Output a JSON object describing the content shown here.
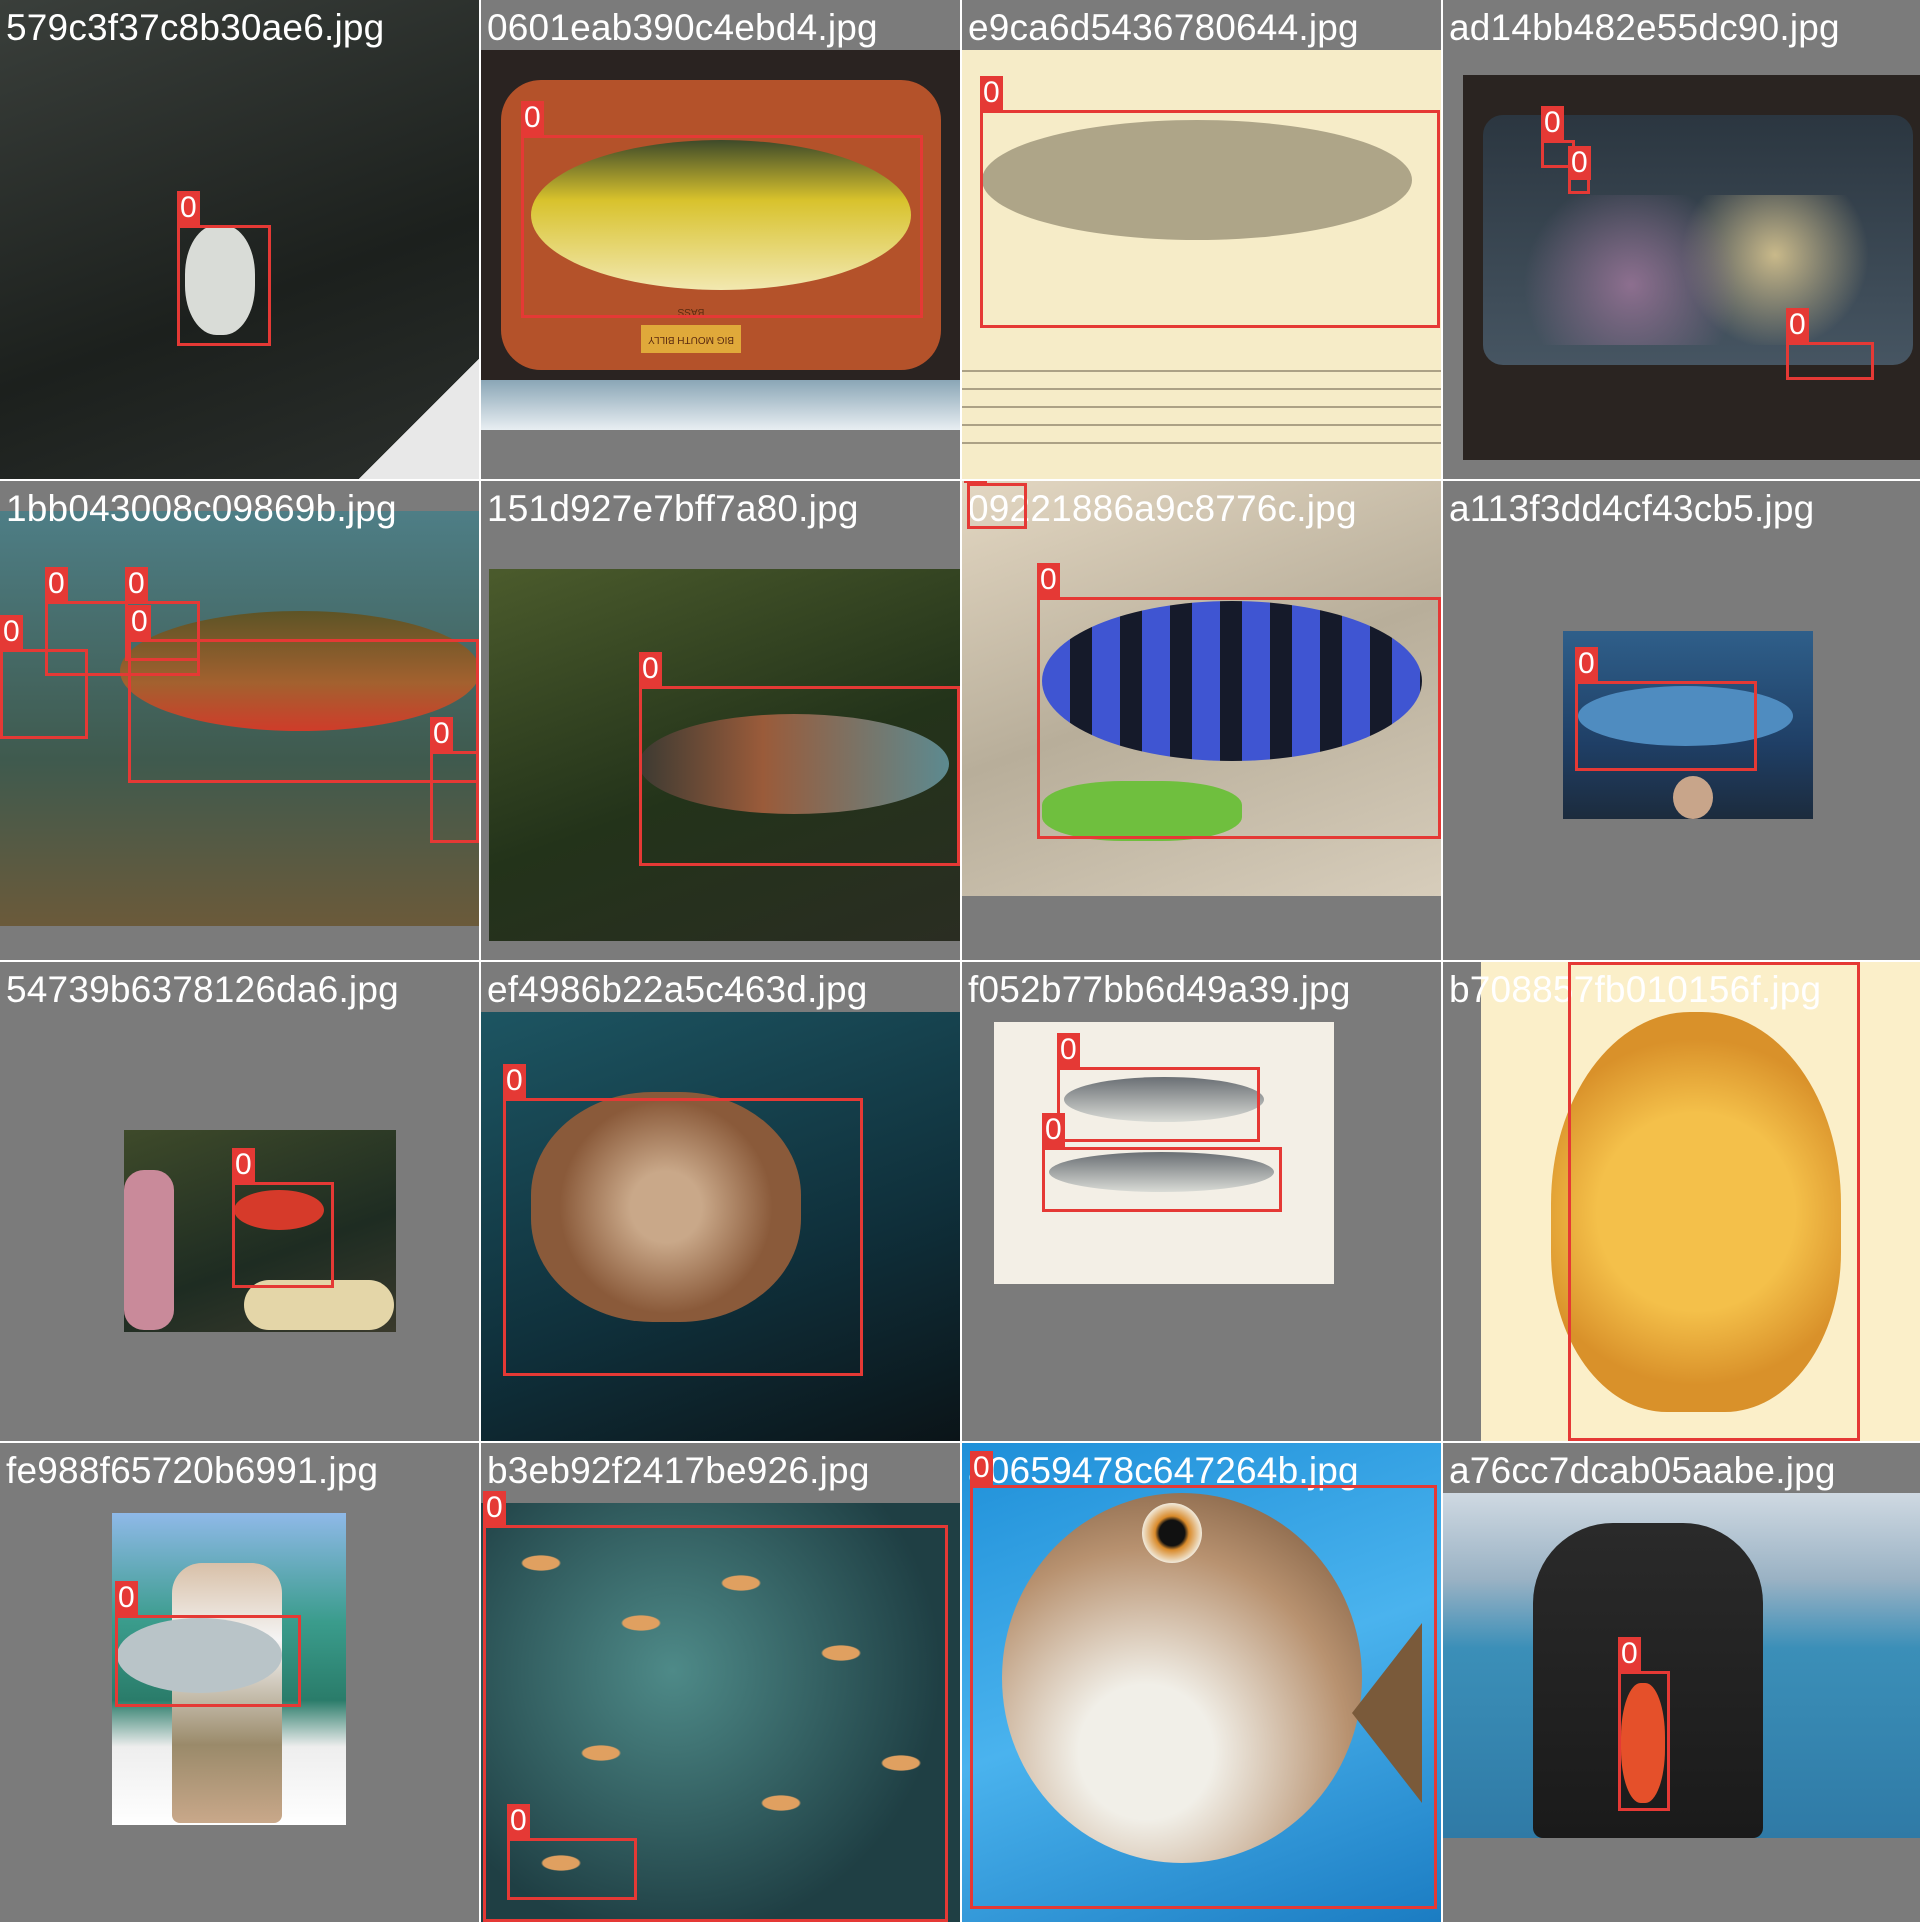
{
  "tiles": [
    {
      "file": "579c3f37c8b30ae6.jpg",
      "boxes": [
        {
          "label": "0"
        }
      ]
    },
    {
      "file": "0601eab390c4ebd4.jpg",
      "boxes": [
        {
          "label": "0"
        }
      ],
      "plaque_text": "BIG MOUTH BILLY BASS"
    },
    {
      "file": "e9ca6d5436780644.jpg",
      "boxes": [
        {
          "label": "0"
        }
      ]
    },
    {
      "file": "ad14bb482e55dc90.jpg",
      "boxes": [
        {
          "label": "0"
        },
        {
          "label": "0"
        },
        {
          "label": "0"
        }
      ]
    },
    {
      "file": "1bb043008c09869b.jpg",
      "boxes": [
        {
          "label": "0"
        },
        {
          "label": "0"
        },
        {
          "label": "0"
        },
        {
          "label": "0"
        },
        {
          "label": "0"
        }
      ]
    },
    {
      "file": "151d927e7bff7a80.jpg",
      "boxes": [
        {
          "label": "0"
        }
      ]
    },
    {
      "file": "09221886a9c8776c.jpg",
      "boxes": [
        {
          "label": "0"
        },
        {
          "label": "0"
        }
      ]
    },
    {
      "file": "a113f3dd4cf43cb5.jpg",
      "boxes": [
        {
          "label": "0"
        }
      ]
    },
    {
      "file": "54739b6378126da6.jpg",
      "boxes": [
        {
          "label": "0"
        }
      ]
    },
    {
      "file": "ef4986b22a5c463d.jpg",
      "boxes": [
        {
          "label": "0"
        }
      ]
    },
    {
      "file": "f052b77bb6d49a39.jpg",
      "boxes": [
        {
          "label": "0"
        },
        {
          "label": "0"
        }
      ]
    },
    {
      "file": "b708857fb010156f.jpg",
      "boxes": [
        {
          "label": "0"
        }
      ]
    },
    {
      "file": "fe988f65720b6991.jpg",
      "boxes": [
        {
          "label": "0"
        }
      ]
    },
    {
      "file": "b3eb92f2417be926.jpg",
      "boxes": [
        {
          "label": "0"
        },
        {
          "label": "0"
        }
      ]
    },
    {
      "file": "a0659478c647264b.jpg",
      "boxes": [
        {
          "label": "0"
        }
      ]
    },
    {
      "file": "a76cc7dcab05aabe.jpg",
      "boxes": [
        {
          "label": "0"
        }
      ]
    }
  ],
  "colors": {
    "box": "#e53935",
    "tile_bg": "#7b7b7b",
    "filename_text": "#ffffff"
  }
}
